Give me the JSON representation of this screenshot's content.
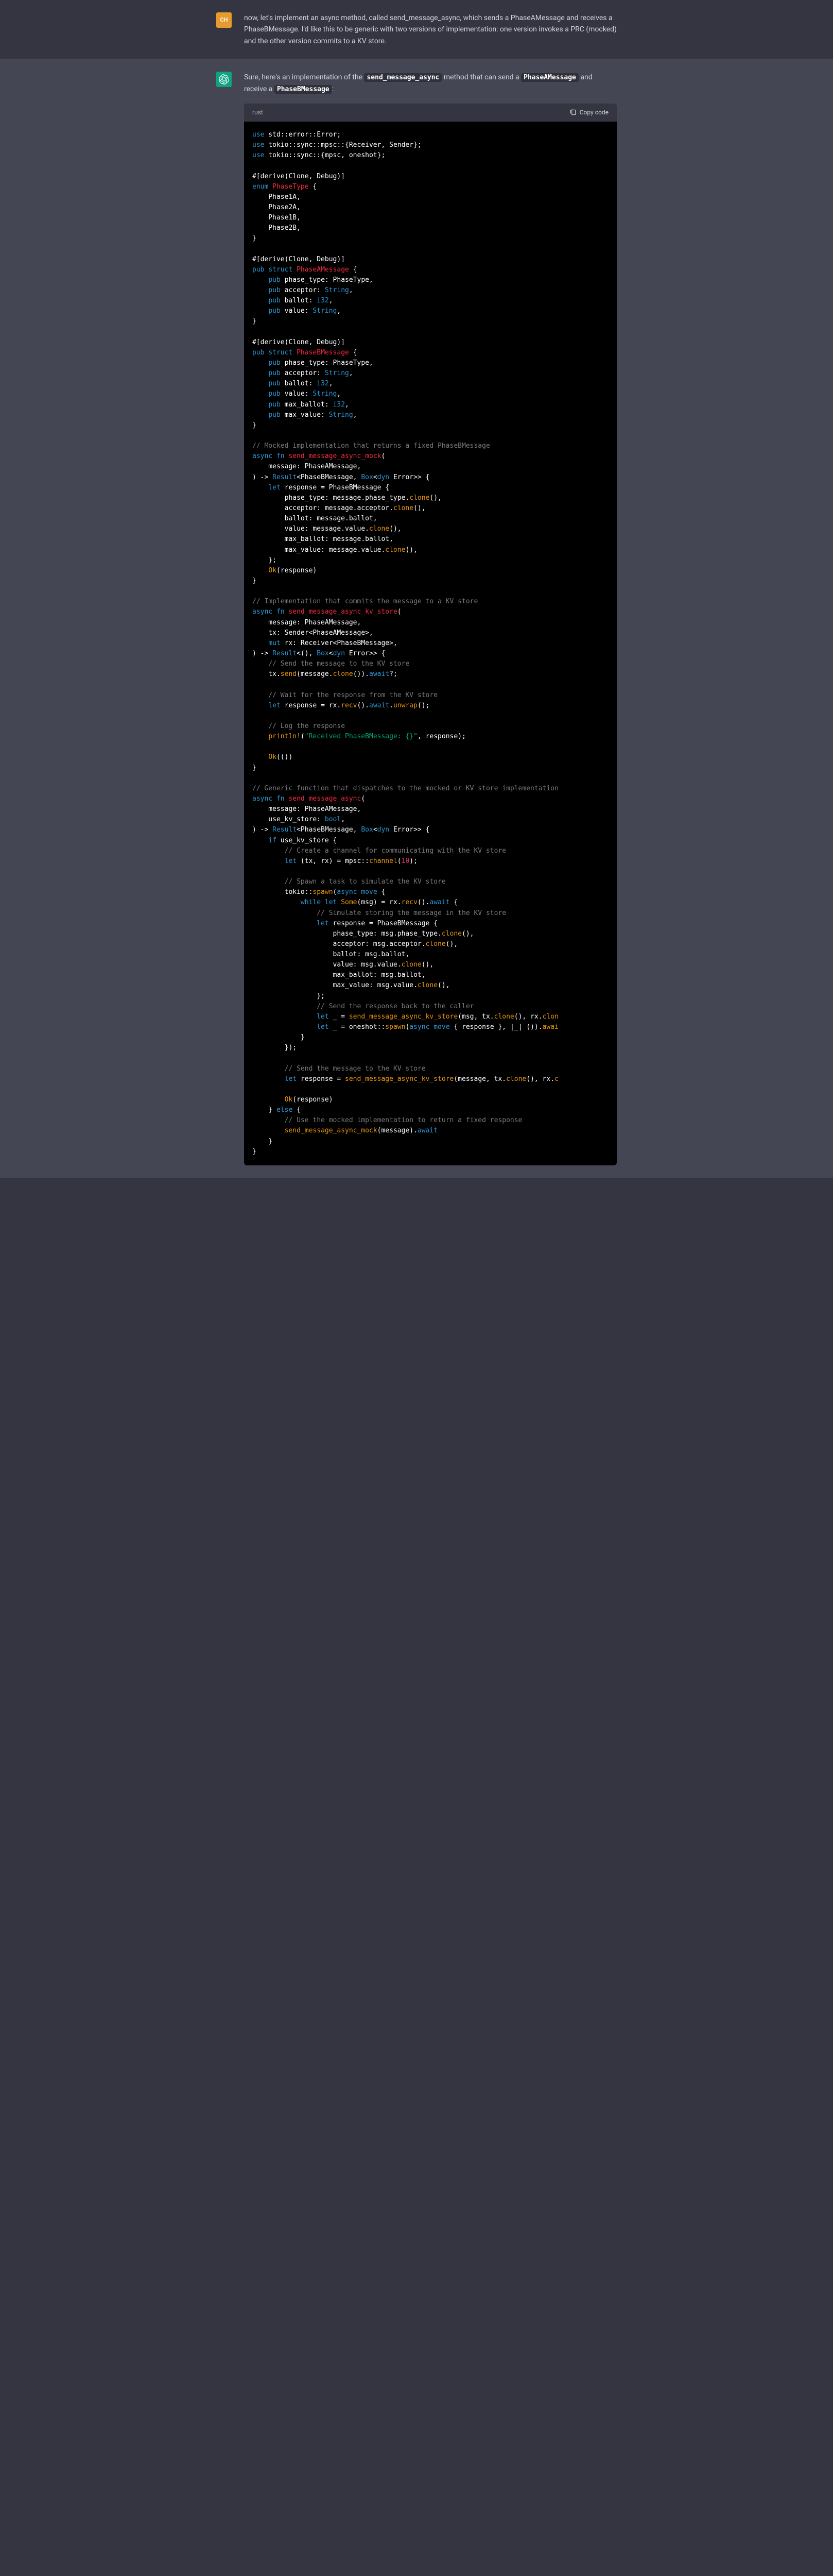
{
  "user_message": "now, let's implement an async method, called send_message_async, which sends a PhaseAMessage and receives a PhaseBMessage. I'd like this to be generic with two versions of implementation: one version invokes a PRC (mocked) and the other version commits to a KV store.",
  "assistant_intro": {
    "prefix": "Sure, here's an implementation of the ",
    "code1": "send_message_async",
    "mid1": " method that can send a ",
    "code2": "PhaseAMessage",
    "mid2": " and receive a ",
    "code3": "PhaseBMessage",
    "suffix": ":"
  },
  "code_lang": "rust",
  "copy_label": "Copy code",
  "user_avatar_label": "CH",
  "code_tokens": [
    [
      [
        "kw",
        "use"
      ],
      [
        "pn",
        " std::error::Error;"
      ]
    ],
    [
      [
        "kw",
        "use"
      ],
      [
        "pn",
        " tokio::sync::mpsc::{Receiver, Sender};"
      ]
    ],
    [
      [
        "kw",
        "use"
      ],
      [
        "pn",
        " tokio::sync::{mpsc, oneshot};"
      ]
    ],
    [],
    [
      [
        "pn",
        "#[derive(Clone, Debug)]"
      ]
    ],
    [
      [
        "kw",
        "enum"
      ],
      [
        "pn",
        " "
      ],
      [
        "fn",
        "PhaseType"
      ],
      [
        "pn",
        " {"
      ]
    ],
    [
      [
        "pn",
        "    Phase1A,"
      ]
    ],
    [
      [
        "pn",
        "    Phase2A,"
      ]
    ],
    [
      [
        "pn",
        "    Phase1B,"
      ]
    ],
    [
      [
        "pn",
        "    Phase2B,"
      ]
    ],
    [
      [
        "pn",
        "}"
      ]
    ],
    [],
    [
      [
        "pn",
        "#[derive(Clone, Debug)]"
      ]
    ],
    [
      [
        "kw",
        "pub"
      ],
      [
        "pn",
        " "
      ],
      [
        "kw",
        "struct"
      ],
      [
        "pn",
        " "
      ],
      [
        "fn",
        "PhaseAMessage"
      ],
      [
        "pn",
        " {"
      ]
    ],
    [
      [
        "pn",
        "    "
      ],
      [
        "kw",
        "pub"
      ],
      [
        "pn",
        " phase_type: PhaseType,"
      ]
    ],
    [
      [
        "pn",
        "    "
      ],
      [
        "kw",
        "pub"
      ],
      [
        "pn",
        " acceptor: "
      ],
      [
        "kw",
        "String"
      ],
      [
        "pn",
        ","
      ]
    ],
    [
      [
        "pn",
        "    "
      ],
      [
        "kw",
        "pub"
      ],
      [
        "pn",
        " ballot: "
      ],
      [
        "kw",
        "i32"
      ],
      [
        "pn",
        ","
      ]
    ],
    [
      [
        "pn",
        "    "
      ],
      [
        "kw",
        "pub"
      ],
      [
        "pn",
        " value: "
      ],
      [
        "kw",
        "String"
      ],
      [
        "pn",
        ","
      ]
    ],
    [
      [
        "pn",
        "}"
      ]
    ],
    [],
    [
      [
        "pn",
        "#[derive(Clone, Debug)]"
      ]
    ],
    [
      [
        "kw",
        "pub"
      ],
      [
        "pn",
        " "
      ],
      [
        "kw",
        "struct"
      ],
      [
        "pn",
        " "
      ],
      [
        "fn",
        "PhaseBMessage"
      ],
      [
        "pn",
        " {"
      ]
    ],
    [
      [
        "pn",
        "    "
      ],
      [
        "kw",
        "pub"
      ],
      [
        "pn",
        " phase_type: PhaseType,"
      ]
    ],
    [
      [
        "pn",
        "    "
      ],
      [
        "kw",
        "pub"
      ],
      [
        "pn",
        " acceptor: "
      ],
      [
        "kw",
        "String"
      ],
      [
        "pn",
        ","
      ]
    ],
    [
      [
        "pn",
        "    "
      ],
      [
        "kw",
        "pub"
      ],
      [
        "pn",
        " ballot: "
      ],
      [
        "kw",
        "i32"
      ],
      [
        "pn",
        ","
      ]
    ],
    [
      [
        "pn",
        "    "
      ],
      [
        "kw",
        "pub"
      ],
      [
        "pn",
        " value: "
      ],
      [
        "kw",
        "String"
      ],
      [
        "pn",
        ","
      ]
    ],
    [
      [
        "pn",
        "    "
      ],
      [
        "kw",
        "pub"
      ],
      [
        "pn",
        " max_ballot: "
      ],
      [
        "kw",
        "i32"
      ],
      [
        "pn",
        ","
      ]
    ],
    [
      [
        "pn",
        "    "
      ],
      [
        "kw",
        "pub"
      ],
      [
        "pn",
        " max_value: "
      ],
      [
        "kw",
        "String"
      ],
      [
        "pn",
        ","
      ]
    ],
    [
      [
        "pn",
        "}"
      ]
    ],
    [],
    [
      [
        "cm",
        "// Mocked implementation that returns a fixed PhaseBMessage"
      ]
    ],
    [
      [
        "kw",
        "async"
      ],
      [
        "pn",
        " "
      ],
      [
        "kw",
        "fn"
      ],
      [
        "pn",
        " "
      ],
      [
        "fn",
        "send_message_async_mock"
      ],
      [
        "pn",
        "("
      ]
    ],
    [
      [
        "pn",
        "    message: PhaseAMessage,"
      ]
    ],
    [
      [
        "pn",
        ") -> "
      ],
      [
        "kw",
        "Result"
      ],
      [
        "pn",
        "<PhaseBMessage, "
      ],
      [
        "kw",
        "Box"
      ],
      [
        "pn",
        "<"
      ],
      [
        "kw",
        "dyn"
      ],
      [
        "pn",
        " Error>> {"
      ]
    ],
    [
      [
        "pn",
        "    "
      ],
      [
        "kw",
        "let"
      ],
      [
        "pn",
        " response = PhaseBMessage {"
      ]
    ],
    [
      [
        "pn",
        "        phase_type: message.phase_type."
      ],
      [
        "call",
        "clone"
      ],
      [
        "pn",
        "(),"
      ]
    ],
    [
      [
        "pn",
        "        acceptor: message.acceptor."
      ],
      [
        "call",
        "clone"
      ],
      [
        "pn",
        "(),"
      ]
    ],
    [
      [
        "pn",
        "        ballot: message.ballot,"
      ]
    ],
    [
      [
        "pn",
        "        value: message.value."
      ],
      [
        "call",
        "clone"
      ],
      [
        "pn",
        "(),"
      ]
    ],
    [
      [
        "pn",
        "        max_ballot: message.ballot,"
      ]
    ],
    [
      [
        "pn",
        "        max_value: message.value."
      ],
      [
        "call",
        "clone"
      ],
      [
        "pn",
        "(),"
      ]
    ],
    [
      [
        "pn",
        "    };"
      ]
    ],
    [
      [
        "pn",
        "    "
      ],
      [
        "call",
        "Ok"
      ],
      [
        "pn",
        "(response)"
      ]
    ],
    [
      [
        "pn",
        "}"
      ]
    ],
    [],
    [
      [
        "cm",
        "// Implementation that commits the message to a KV store"
      ]
    ],
    [
      [
        "kw",
        "async"
      ],
      [
        "pn",
        " "
      ],
      [
        "kw",
        "fn"
      ],
      [
        "pn",
        " "
      ],
      [
        "fn",
        "send_message_async_kv_store"
      ],
      [
        "pn",
        "("
      ]
    ],
    [
      [
        "pn",
        "    message: PhaseAMessage,"
      ]
    ],
    [
      [
        "pn",
        "    tx: Sender<PhaseAMessage>,"
      ]
    ],
    [
      [
        "pn",
        "    "
      ],
      [
        "kw",
        "mut"
      ],
      [
        "pn",
        " rx: Receiver<PhaseBMessage>,"
      ]
    ],
    [
      [
        "pn",
        ") -> "
      ],
      [
        "kw",
        "Result"
      ],
      [
        "pn",
        "<(), "
      ],
      [
        "kw",
        "Box"
      ],
      [
        "pn",
        "<"
      ],
      [
        "kw",
        "dyn"
      ],
      [
        "pn",
        " Error>> {"
      ]
    ],
    [
      [
        "pn",
        "    "
      ],
      [
        "cm",
        "// Send the message to the KV store"
      ]
    ],
    [
      [
        "pn",
        "    tx."
      ],
      [
        "call",
        "send"
      ],
      [
        "pn",
        "(message."
      ],
      [
        "call",
        "clone"
      ],
      [
        "pn",
        "())."
      ],
      [
        "kw",
        "await"
      ],
      [
        "pn",
        "?;"
      ]
    ],
    [],
    [
      [
        "pn",
        "    "
      ],
      [
        "cm",
        "// Wait for the response from the KV store"
      ]
    ],
    [
      [
        "pn",
        "    "
      ],
      [
        "kw",
        "let"
      ],
      [
        "pn",
        " response = rx."
      ],
      [
        "call",
        "recv"
      ],
      [
        "pn",
        "()."
      ],
      [
        "kw",
        "await"
      ],
      [
        "pn",
        "."
      ],
      [
        "call",
        "unwrap"
      ],
      [
        "pn",
        "();"
      ]
    ],
    [],
    [
      [
        "pn",
        "    "
      ],
      [
        "cm",
        "// Log the response"
      ]
    ],
    [
      [
        "pn",
        "    "
      ],
      [
        "mac",
        "println!"
      ],
      [
        "pn",
        "("
      ],
      [
        "str",
        "\"Received PhaseBMessage: {}\""
      ],
      [
        "pn",
        ", response);"
      ]
    ],
    [],
    [
      [
        "pn",
        "    "
      ],
      [
        "call",
        "Ok"
      ],
      [
        "pn",
        "(())"
      ]
    ],
    [
      [
        "pn",
        "}"
      ]
    ],
    [],
    [
      [
        "cm",
        "// Generic function that dispatches to the mocked or KV store implementation"
      ]
    ],
    [
      [
        "kw",
        "async"
      ],
      [
        "pn",
        " "
      ],
      [
        "kw",
        "fn"
      ],
      [
        "pn",
        " "
      ],
      [
        "fn",
        "send_message_async"
      ],
      [
        "pn",
        "("
      ]
    ],
    [
      [
        "pn",
        "    message: PhaseAMessage,"
      ]
    ],
    [
      [
        "pn",
        "    use_kv_store: "
      ],
      [
        "kw",
        "bool"
      ],
      [
        "pn",
        ","
      ]
    ],
    [
      [
        "pn",
        ") -> "
      ],
      [
        "kw",
        "Result"
      ],
      [
        "pn",
        "<PhaseBMessage, "
      ],
      [
        "kw",
        "Box"
      ],
      [
        "pn",
        "<"
      ],
      [
        "kw",
        "dyn"
      ],
      [
        "pn",
        " Error>> {"
      ]
    ],
    [
      [
        "pn",
        "    "
      ],
      [
        "kw",
        "if"
      ],
      [
        "pn",
        " use_kv_store {"
      ]
    ],
    [
      [
        "pn",
        "        "
      ],
      [
        "cm",
        "// Create a channel for communicating with the KV store"
      ]
    ],
    [
      [
        "pn",
        "        "
      ],
      [
        "kw",
        "let"
      ],
      [
        "pn",
        " (tx, rx) = mpsc::"
      ],
      [
        "call",
        "channel"
      ],
      [
        "pn",
        "("
      ],
      [
        "num",
        "10"
      ],
      [
        "pn",
        ");"
      ]
    ],
    [],
    [
      [
        "pn",
        "        "
      ],
      [
        "cm",
        "// Spawn a task to simulate the KV store"
      ]
    ],
    [
      [
        "pn",
        "        tokio::"
      ],
      [
        "call",
        "spawn"
      ],
      [
        "pn",
        "("
      ],
      [
        "kw",
        "async"
      ],
      [
        "pn",
        " "
      ],
      [
        "kw",
        "move"
      ],
      [
        "pn",
        " {"
      ]
    ],
    [
      [
        "pn",
        "            "
      ],
      [
        "kw",
        "while"
      ],
      [
        "pn",
        " "
      ],
      [
        "kw",
        "let"
      ],
      [
        "pn",
        " "
      ],
      [
        "call",
        "Some"
      ],
      [
        "pn",
        "(msg) = rx."
      ],
      [
        "call",
        "recv"
      ],
      [
        "pn",
        "()."
      ],
      [
        "kw",
        "await"
      ],
      [
        "pn",
        " {"
      ]
    ],
    [
      [
        "pn",
        "                "
      ],
      [
        "cm",
        "// Simulate storing the message in the KV store"
      ]
    ],
    [
      [
        "pn",
        "                "
      ],
      [
        "kw",
        "let"
      ],
      [
        "pn",
        " response = PhaseBMessage {"
      ]
    ],
    [
      [
        "pn",
        "                    phase_type: msg.phase_type."
      ],
      [
        "call",
        "clone"
      ],
      [
        "pn",
        "(),"
      ]
    ],
    [
      [
        "pn",
        "                    acceptor: msg.acceptor."
      ],
      [
        "call",
        "clone"
      ],
      [
        "pn",
        "(),"
      ]
    ],
    [
      [
        "pn",
        "                    ballot: msg.ballot,"
      ]
    ],
    [
      [
        "pn",
        "                    value: msg.value."
      ],
      [
        "call",
        "clone"
      ],
      [
        "pn",
        "(),"
      ]
    ],
    [
      [
        "pn",
        "                    max_ballot: msg.ballot,"
      ]
    ],
    [
      [
        "pn",
        "                    max_value: msg.value."
      ],
      [
        "call",
        "clone"
      ],
      [
        "pn",
        "(),"
      ]
    ],
    [
      [
        "pn",
        "                };"
      ]
    ],
    [
      [
        "pn",
        "                "
      ],
      [
        "cm",
        "// Send the response back to the caller"
      ]
    ],
    [
      [
        "pn",
        "                "
      ],
      [
        "kw",
        "let"
      ],
      [
        "pn",
        " _ = "
      ],
      [
        "call",
        "send_message_async_kv_store"
      ],
      [
        "pn",
        "(msg, tx."
      ],
      [
        "call",
        "clone"
      ],
      [
        "pn",
        "(), rx."
      ],
      [
        "call",
        "clon"
      ]
    ],
    [
      [
        "pn",
        "                "
      ],
      [
        "kw",
        "let"
      ],
      [
        "pn",
        " _ = oneshot::"
      ],
      [
        "call",
        "spawn"
      ],
      [
        "pn",
        "("
      ],
      [
        "kw",
        "async"
      ],
      [
        "pn",
        " "
      ],
      [
        "kw",
        "move"
      ],
      [
        "pn",
        " { response }, |_| ())."
      ],
      [
        "call",
        "awai"
      ]
    ],
    [
      [
        "pn",
        "            }"
      ]
    ],
    [
      [
        "pn",
        "        });"
      ]
    ],
    [],
    [
      [
        "pn",
        "        "
      ],
      [
        "cm",
        "// Send the message to the KV store"
      ]
    ],
    [
      [
        "pn",
        "        "
      ],
      [
        "kw",
        "let"
      ],
      [
        "pn",
        " response = "
      ],
      [
        "call",
        "send_message_async_kv_store"
      ],
      [
        "pn",
        "(message, tx."
      ],
      [
        "call",
        "clone"
      ],
      [
        "pn",
        "(), rx."
      ],
      [
        "call",
        "c"
      ]
    ],
    [],
    [
      [
        "pn",
        "        "
      ],
      [
        "call",
        "Ok"
      ],
      [
        "pn",
        "(response)"
      ]
    ],
    [
      [
        "pn",
        "    } "
      ],
      [
        "kw",
        "else"
      ],
      [
        "pn",
        " {"
      ]
    ],
    [
      [
        "pn",
        "        "
      ],
      [
        "cm",
        "// Use the mocked implementation to return a fixed response"
      ]
    ],
    [
      [
        "pn",
        "        "
      ],
      [
        "call",
        "send_message_async_mock"
      ],
      [
        "pn",
        "(message)."
      ],
      [
        "kw",
        "await"
      ]
    ],
    [
      [
        "pn",
        "    }"
      ]
    ],
    [
      [
        "pn",
        "}"
      ]
    ]
  ]
}
